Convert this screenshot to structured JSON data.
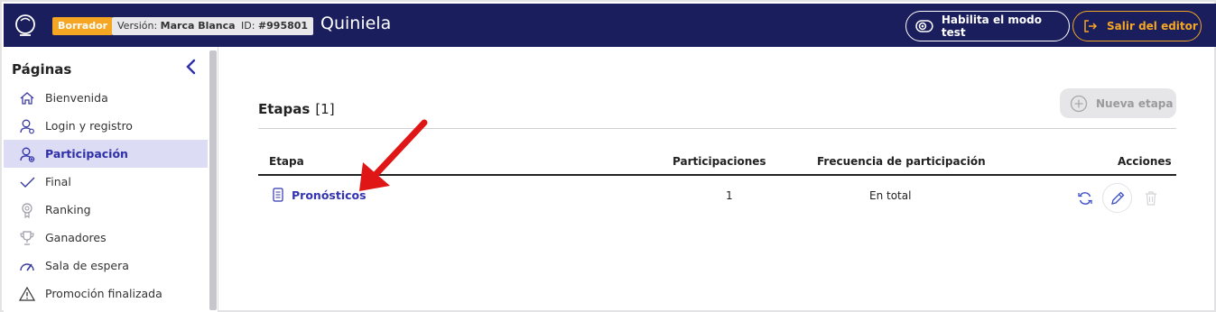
{
  "header": {
    "status_badge": "Borrador",
    "version_label": "Versión:",
    "version_value": "Marca Blanca",
    "id_label": "ID:",
    "id_value": "#995801",
    "title": "Quiniela",
    "test_mode_label": "Habilita el modo test",
    "exit_label": "Salir del editor"
  },
  "sidebar": {
    "title": "Páginas",
    "items": [
      {
        "label": "Bienvenida",
        "icon": "home-icon"
      },
      {
        "label": "Login y registro",
        "icon": "user-settings-icon"
      },
      {
        "label": "Participación",
        "icon": "user-add-icon",
        "active": true
      },
      {
        "label": "Final",
        "icon": "check-icon"
      },
      {
        "label": "Ranking",
        "icon": "medal-icon"
      },
      {
        "label": "Ganadores",
        "icon": "trophy-icon"
      },
      {
        "label": "Sala de espera",
        "icon": "speedometer-icon"
      },
      {
        "label": "Promoción finalizada",
        "icon": "warning-icon"
      }
    ]
  },
  "main": {
    "section_title": "Etapas",
    "section_count": "[1]",
    "new_stage_label": "Nueva etapa",
    "columns": [
      "Etapa",
      "Participaciones",
      "Frecuencia de participación",
      "Acciones"
    ],
    "rows": [
      {
        "stage": "Pronósticos",
        "participations": "1",
        "frequency": "En total"
      }
    ]
  },
  "colors": {
    "header_bg": "#1b1e5c",
    "accent_orange": "#f5a623",
    "link_blue": "#3333b3",
    "active_bg": "#dcdcf5",
    "annotation_red": "#e01515"
  }
}
